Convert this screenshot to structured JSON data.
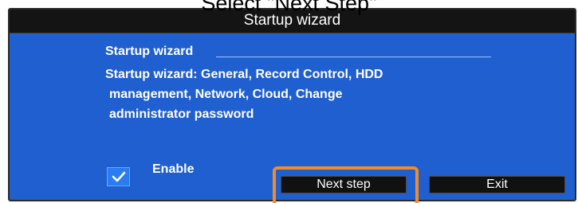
{
  "caption": "Select \"Next Step\"",
  "dialog": {
    "title": "Startup wizard",
    "section_heading": "Startup wizard",
    "description_lines": [
      "Startup wizard: General, Record Control, HDD",
      "management, Network, Cloud, Change",
      "administrator password"
    ],
    "enable": {
      "label": "Enable",
      "checked": true
    },
    "buttons": {
      "next_label": "Next step",
      "exit_label": "Exit"
    }
  },
  "colors": {
    "dialog_background": "#1f5fd0",
    "title_bar": "#141414",
    "checkbox": "#2a7df0",
    "highlight": "#f28c28"
  },
  "icons": {
    "checkbox_check": "check-icon"
  }
}
